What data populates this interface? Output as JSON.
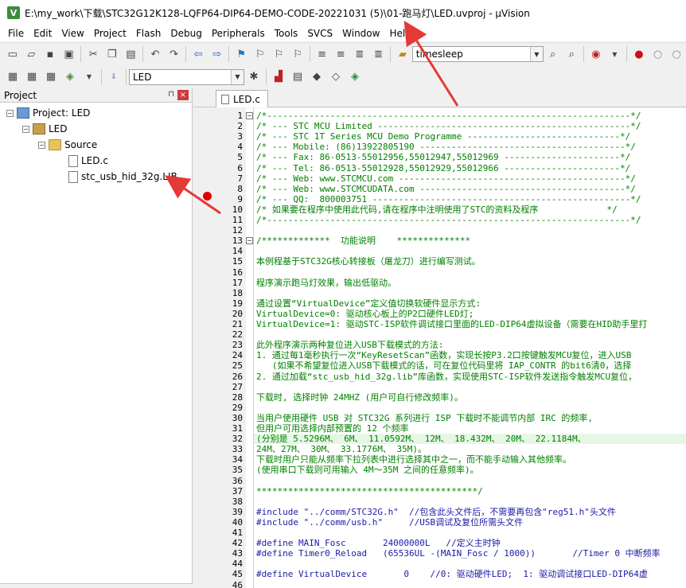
{
  "window": {
    "title": "E:\\my_work\\下载\\STC32G12K128-LQFP64-DIP64-DEMO-CODE-20221031 (5)\\01-跑马灯\\LED.uvproj - µVision",
    "app_icon": "V"
  },
  "menu": [
    "File",
    "Edit",
    "View",
    "Project",
    "Flash",
    "Debug",
    "Peripherals",
    "Tools",
    "SVCS",
    "Window",
    "Help"
  ],
  "toolbar": {
    "find_combo_value": "timesleep",
    "target_combo_value": "LED"
  },
  "project_panel": {
    "title": "Project",
    "pin": "⊓",
    "close": "×",
    "tree": [
      {
        "label": "Project: LED",
        "level": 0,
        "type": "project"
      },
      {
        "label": "LED",
        "level": 1,
        "type": "target"
      },
      {
        "label": "Source",
        "level": 2,
        "type": "folder"
      },
      {
        "label": "LED.c",
        "level": 3,
        "type": "file"
      },
      {
        "label": "stc_usb_hid_32g.LIB",
        "level": 3,
        "type": "file"
      }
    ]
  },
  "editor": {
    "tab_label": "LED.c",
    "lines": [
      {
        "n": "1",
        "text": "/*---------------------------------------------------------------------*/"
      },
      {
        "n": "2",
        "text": "/* --- STC MCU Limited ------------------------------------------------*/"
      },
      {
        "n": "3",
        "text": "/* --- STC 1T Series MCU Demo Programme -----------------------------*/"
      },
      {
        "n": "4",
        "text": "/* --- Mobile: (86)13922805190 ---------------------------------------*/"
      },
      {
        "n": "5",
        "text": "/* --- Fax: 86-0513-55012956,55012947,55012969 ----------------------*/"
      },
      {
        "n": "6",
        "text": "/* --- Tel: 86-0513-55012928,55012929,55012966 ----------------------*/"
      },
      {
        "n": "7",
        "text": "/* --- Web: www.STCMCU.com -------------------------------------------*/"
      },
      {
        "n": "8",
        "text": "/* --- Web: www.STCMCUDATA.com ---------------------------------------*/"
      },
      {
        "n": "9",
        "text": "/* --- QQ:  800003751 -------------------------------------------------*/"
      },
      {
        "n": "10",
        "text": "/* 如果要在程序中使用此代码,请在程序中注明使用了STC的资料及程序             */"
      },
      {
        "n": "11",
        "text": "/*---------------------------------------------------------------------*/"
      },
      {
        "n": "12",
        "text": ""
      },
      {
        "n": "13",
        "text": "/*************  功能说明    **************"
      },
      {
        "n": "14",
        "text": ""
      },
      {
        "n": "15",
        "text": "本例程基于STC32G核心转接板（屠龙刀）进行编写测试。"
      },
      {
        "n": "16",
        "text": ""
      },
      {
        "n": "17",
        "text": "程序演示跑马灯效果，输出低驱动。"
      },
      {
        "n": "18",
        "text": ""
      },
      {
        "n": "19",
        "text": "通过设置“VirtualDevice”定义值切换软硬件显示方式:"
      },
      {
        "n": "20",
        "text": "VirtualDevice=0: 驱动核心板上的P2口硬件LED灯;"
      },
      {
        "n": "21",
        "text": "VirtualDevice=1: 驱动STC-ISP软件调试接口里面的LED-DIP64虚拟设备（需要在HID助手里打"
      },
      {
        "n": "22",
        "text": ""
      },
      {
        "n": "23",
        "text": "此外程序演示两种复位进入USB下载模式的方法:"
      },
      {
        "n": "24",
        "text": "1. 通过每1毫秒执行一次“KeyResetScan”函数，实现长按P3.2口按键触发MCU复位，进入USB"
      },
      {
        "n": "25",
        "text": "   (如果不希望复位进入USB下载模式的话，可在复位代码里将 IAP_CONTR 的bit6清0，选择"
      },
      {
        "n": "26",
        "text": "2. 通过加载“stc_usb_hid_32g.lib”库函数，实现使用STC-ISP软件发送指令触发MCU复位，"
      },
      {
        "n": "27",
        "text": ""
      },
      {
        "n": "28",
        "text": "下载时, 选择时钟 24MHZ (用户可自行修改频率)。"
      },
      {
        "n": "29",
        "text": ""
      },
      {
        "n": "30",
        "text": "当用户使用硬件 USB 对 STC32G 系列进行 ISP 下载时不能调节内部 IRC 的频率,"
      },
      {
        "n": "31",
        "text": "但用户可用选择内部预置的 12 个频率"
      },
      {
        "n": "32",
        "text": "(分别是 5.5296M、 6M、 11.0592M、 12M、 18.432M、 20M、 22.1184M、"
      },
      {
        "n": "33",
        "text": "24M、27M、 30M、 33.1776M、 35M)。"
      },
      {
        "n": "34",
        "text": "下载时用户只能从频率下拉列表中进行选择其中之一，而不能手动输入其他频率。"
      },
      {
        "n": "35",
        "text": "(使用串口下载则可用输入 4M～35M 之间的任意频率)。"
      },
      {
        "n": "36",
        "text": ""
      },
      {
        "n": "37",
        "text": "******************************************/"
      },
      {
        "n": "38",
        "text": ""
      },
      {
        "n": "39",
        "text": "#include \"../comm/STC32G.h\"  //包含此头文件后，不需要再包含\"reg51.h\"头文件"
      },
      {
        "n": "40",
        "text": "#include \"../comm/usb.h\"     //USB调试及复位所需头文件"
      },
      {
        "n": "41",
        "text": ""
      },
      {
        "n": "42",
        "text": "#define MAIN_Fosc       24000000L   //定义主时钟"
      },
      {
        "n": "43",
        "text": "#define Timer0_Reload   (65536UL -(MAIN_Fosc / 1000))       //Timer 0 中断频率"
      },
      {
        "n": "44",
        "text": ""
      },
      {
        "n": "45",
        "text": "#define VirtualDevice       0    //0: 驱动硬件LED;  1: 驱动调试接口LED-DIP64虚"
      },
      {
        "n": "46",
        "text": ""
      }
    ]
  },
  "annotation_color": "#e53935"
}
